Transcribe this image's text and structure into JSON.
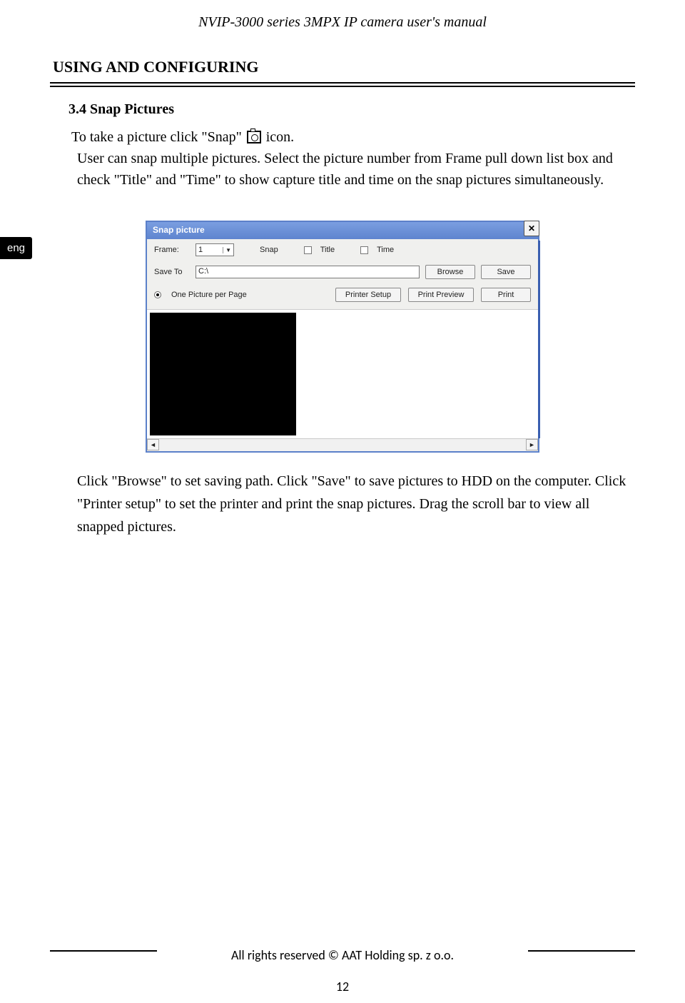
{
  "header": "NVIP-3000 series 3MPX IP camera user's manual",
  "section_heading": "USING AND CONFIGURING",
  "subsection_heading": "3.4 Snap Pictures",
  "intro_prefix": "To take a picture click \"Snap\" ",
  "intro_suffix": " icon.",
  "para1": "User can snap multiple pictures. Select the picture number from Frame pull down list box and check \"Title\" and \"Time\" to show capture title and time on the snap pictures simultaneously.",
  "para2": "Click \"Browse\" to set saving path. Click \"Save\" to save pictures to HDD on the computer. Click \"Printer setup\" to set the printer and print the snap pictures. Drag the scroll bar to view all snapped pictures.",
  "side_tab": "eng",
  "dialog": {
    "title": "Snap picture",
    "close": "✕",
    "frame_label": "Frame:",
    "frame_value": "1",
    "snap_btn": "Snap",
    "title_chk": "Title",
    "time_chk": "Time",
    "save_to_label": "Save To",
    "path_value": "C:\\",
    "browse_btn": "Browse",
    "save_btn": "Save",
    "radio_label": "One Picture per Page",
    "printer_setup_btn": "Printer Setup",
    "print_preview_btn": "Print Preview",
    "print_btn": "Print"
  },
  "footer": "All rights reserved © AAT Holding sp. z o.o.",
  "page_number": "12"
}
